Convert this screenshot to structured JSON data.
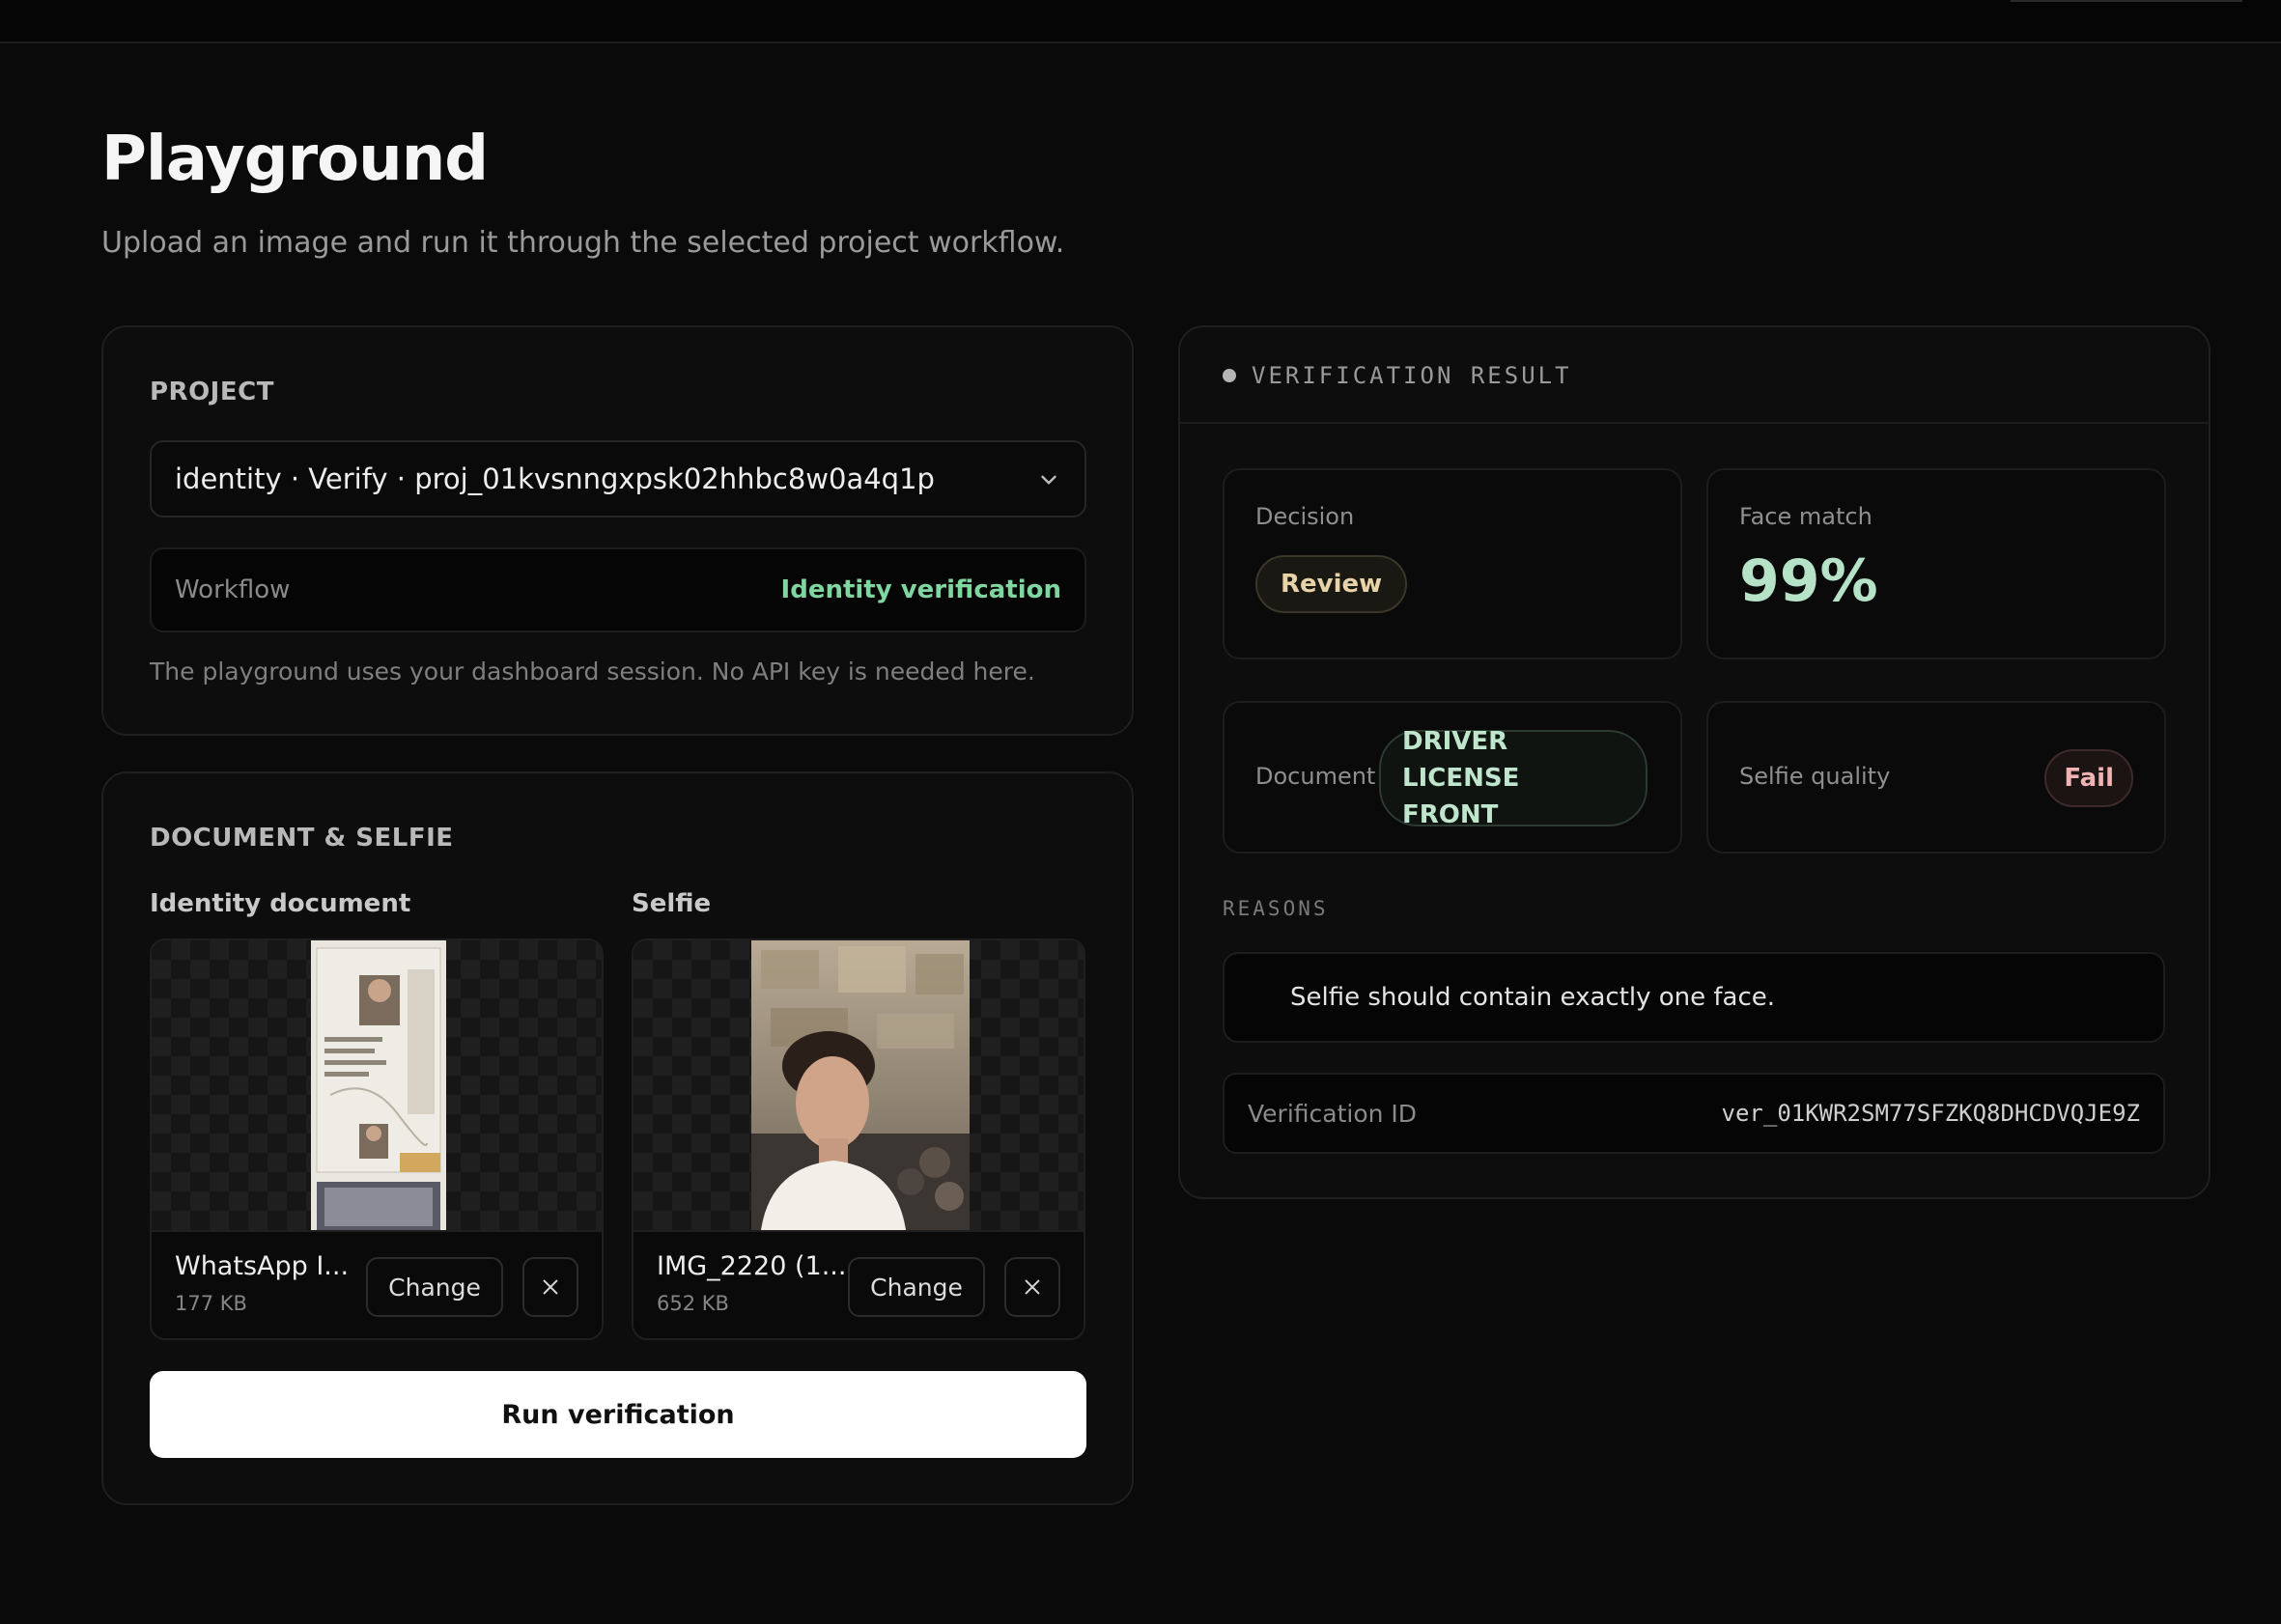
{
  "page": {
    "title": "Playground",
    "subtitle": "Upload an image and run it through the selected project workflow."
  },
  "project": {
    "section_label": "PROJECT",
    "selected": "identity · Verify · proj_01kvsnngxpsk02hhbc8w0a4q1p",
    "workflow_label": "Workflow",
    "workflow_value": "Identity verification",
    "note": "The playground uses your dashboard session. No API key is needed here."
  },
  "uploads": {
    "section_label": "DOCUMENT & SELFIE",
    "document": {
      "label": "Identity document",
      "file_name": "WhatsApp I...",
      "file_size": "177 KB",
      "change_label": "Change"
    },
    "selfie": {
      "label": "Selfie",
      "file_name": "IMG_2220 (1...",
      "file_size": "652 KB",
      "change_label": "Change"
    },
    "run_label": "Run verification"
  },
  "result": {
    "title": "VERIFICATION RESULT",
    "decision_label": "Decision",
    "decision_value": "Review",
    "face_match_label": "Face match",
    "face_match_value": "99%",
    "document_label": "Document",
    "document_value_line1": "DRIVER LICENSE",
    "document_value_line2": "FRONT",
    "selfie_quality_label": "Selfie quality",
    "selfie_quality_value": "Fail",
    "reasons_label": "REASONS",
    "reasons": [
      "Selfie should contain exactly one face."
    ],
    "verification_id_label": "Verification ID",
    "verification_id_value": "ver_01KWR2SM77SFZKQ8DHCDVQJE9Z"
  },
  "colors": {
    "background": "#0a0a0a",
    "accent_green": "#7fd6a0",
    "review_pill": "#e8d3a8",
    "fail_pill": "#f0b3b3",
    "face_match": "#b6e3c7"
  },
  "icons": [
    "chevron-down-icon",
    "close-icon",
    "status-dot-icon"
  ]
}
